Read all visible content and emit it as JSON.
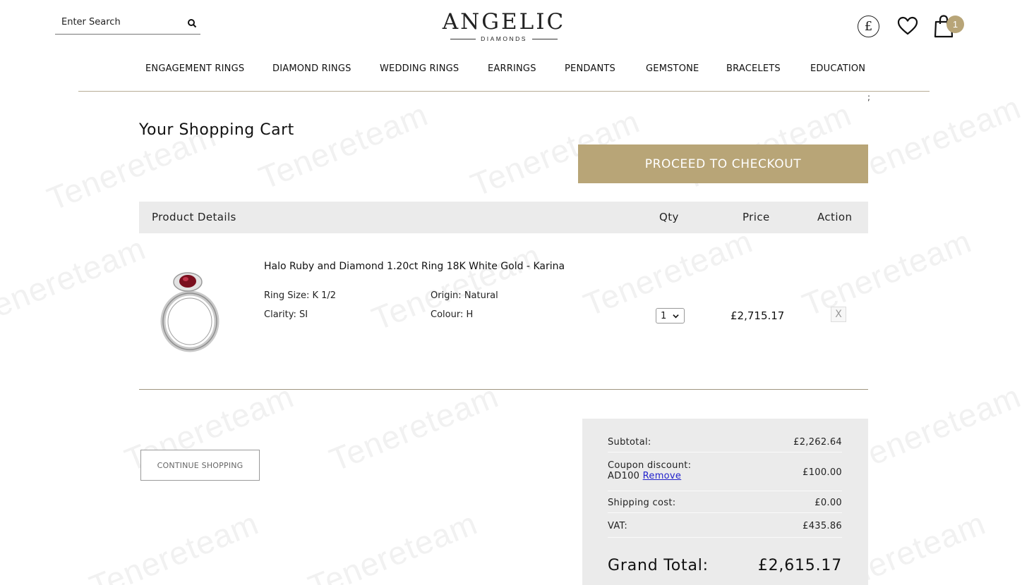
{
  "header": {
    "search_placeholder": "Enter Search",
    "brand": "ANGELIC",
    "brand_sub": "DIAMONDS",
    "currency_symbol": "£",
    "cart_count": "1"
  },
  "nav": [
    "ENGAGEMENT RINGS",
    "DIAMOND RINGS",
    "WEDDING RINGS",
    "EARRINGS",
    "PENDANTS",
    "GEMSTONE",
    "BRACELETS",
    "EDUCATION"
  ],
  "nav_trailing": ";",
  "cart": {
    "title": "Your Shopping Cart",
    "checkout_label": "PROCEED TO CHECKOUT",
    "columns": {
      "product": "Product Details",
      "qty": "Qty",
      "price": "Price",
      "action": "Action"
    },
    "item": {
      "name": "Halo Ruby and Diamond 1.20ct Ring 18K White Gold - Karina",
      "ring_size_label": "Ring Size:",
      "ring_size": "K 1/2",
      "origin_label": "Origin:",
      "origin": "Natural",
      "clarity_label": "Clarity:",
      "clarity": "SI",
      "colour_label": "Colour:",
      "colour": "H",
      "qty": "1",
      "price": "£2,715.17",
      "remove_symbol": "X"
    },
    "continue_label": "CONTINUE SHOPPING"
  },
  "summary": {
    "subtotal_label": "Subtotal:",
    "subtotal": "£2,262.64",
    "coupon_label": "Coupon discount:",
    "coupon_code": "AD100",
    "coupon_remove": "Remove",
    "coupon_value": "£100.00",
    "shipping_label": "Shipping cost:",
    "shipping": "£0.00",
    "vat_label": "VAT:",
    "vat": "£435.86",
    "grand_label": "Grand Total:",
    "grand": "£2,615.17"
  },
  "watermark": "Tenereteam",
  "colors": {
    "accent_gold": "#b8a577",
    "header_bg": "#ebebeb",
    "rule": "#a09680"
  }
}
